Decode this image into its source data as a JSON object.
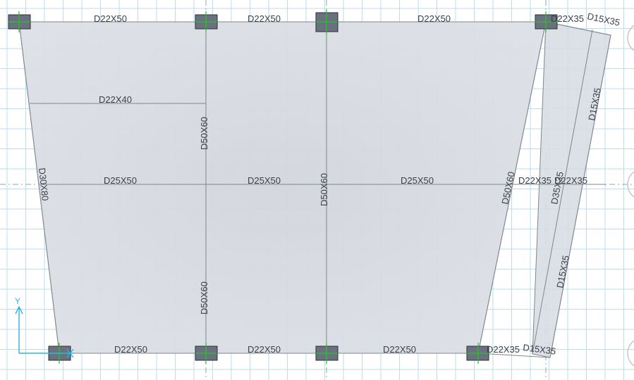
{
  "colors": {
    "background": "#ffffff",
    "grid": "#b9dcee",
    "slab": "#d7dce3",
    "beam": "#7f868d",
    "column": "#6a717e",
    "marker": "#27c22b",
    "axis": "#2fb3e4"
  },
  "labels": {
    "top_beam_1": "D22X50",
    "top_beam_2": "D22X50",
    "top_beam_3": "D22X50",
    "top_beam_4": "D22X35",
    "top_beam_5": "D15X35",
    "secondary_beam": "D22X40",
    "left_edge_beam": "D30X80",
    "mid_col_beam_upper": "D50X60",
    "mid_col_beam_lower": "D50X60",
    "center_col_beam": "D50X60",
    "middle_beam_1": "D25X50",
    "middle_beam_2": "D25X50",
    "middle_beam_3": "D25X50",
    "middle_beam_4": "D22X35",
    "middle_beam_5": "D22X35",
    "slanted_beam_1": "D50X60",
    "slanted_beam_2": "D35X35",
    "slanted_beam_3": "D15X35",
    "slanted_beam_4": "D15X35",
    "bottom_beam_1": "D22X50",
    "bottom_beam_2": "D22X50",
    "bottom_beam_3": "D22X50",
    "bottom_beam_4": "D22X35",
    "bottom_beam_5": "D15X35",
    "axis_y": "Y"
  }
}
